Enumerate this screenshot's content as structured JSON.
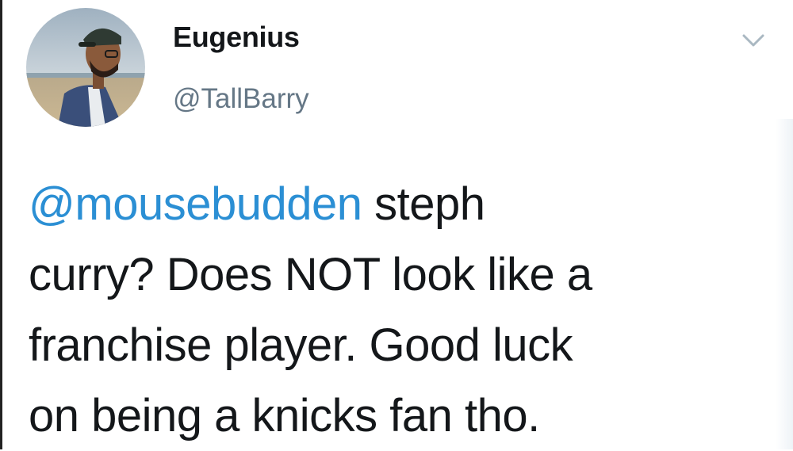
{
  "author": {
    "display_name": "Eugenius",
    "handle": "@TallBarry",
    "avatar_icon": "profile-photo"
  },
  "menu": {
    "icon": "chevron-down-icon"
  },
  "tweet": {
    "mention": "@mousebudden",
    "line1_rest": " steph",
    "line2": "curry? Does NOT look like a",
    "line3": "franchise player. Good luck",
    "line4": "on being a knicks fan tho."
  },
  "colors": {
    "mention": "#2b8fd4",
    "text": "#14171a",
    "handle": "#657786",
    "caret": "#aab8c2"
  }
}
